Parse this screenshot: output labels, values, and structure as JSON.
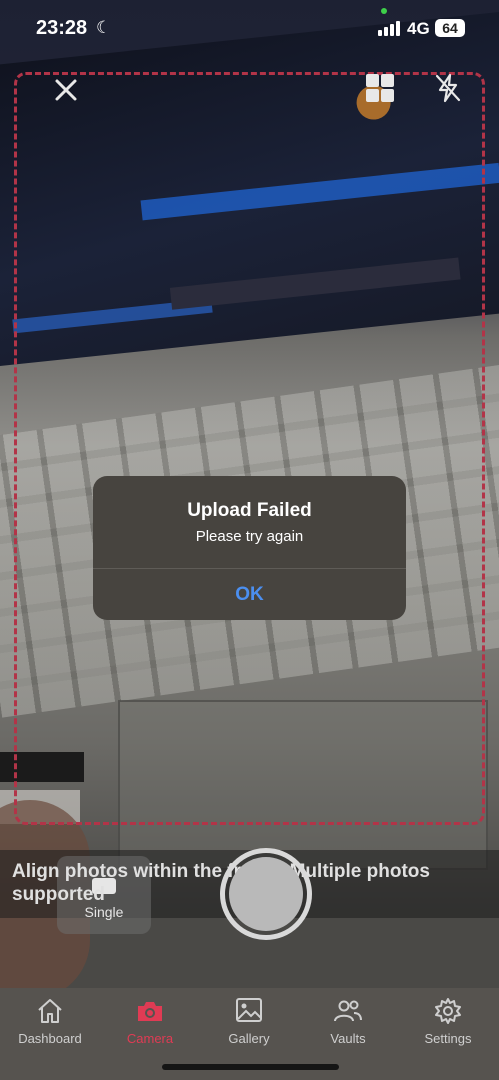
{
  "status_bar": {
    "time": "23:28",
    "network": "4G",
    "battery": "64"
  },
  "camera": {
    "hint": "Align photos within the frame. Multiple photos supported",
    "mode_label": "Single"
  },
  "dialog": {
    "title": "Upload Failed",
    "message": "Please try again",
    "ok_label": "OK"
  },
  "tabs": [
    {
      "label": "Dashboard",
      "icon": "home-icon",
      "active": false
    },
    {
      "label": "Camera",
      "icon": "camera-icon",
      "active": true
    },
    {
      "label": "Gallery",
      "icon": "gallery-icon",
      "active": false
    },
    {
      "label": "Vaults",
      "icon": "people-icon",
      "active": false
    },
    {
      "label": "Settings",
      "icon": "gear-icon",
      "active": false
    }
  ],
  "colors": {
    "accent": "#e03b54",
    "frame": "#b23448",
    "dialog_button": "#4b8ff0"
  }
}
